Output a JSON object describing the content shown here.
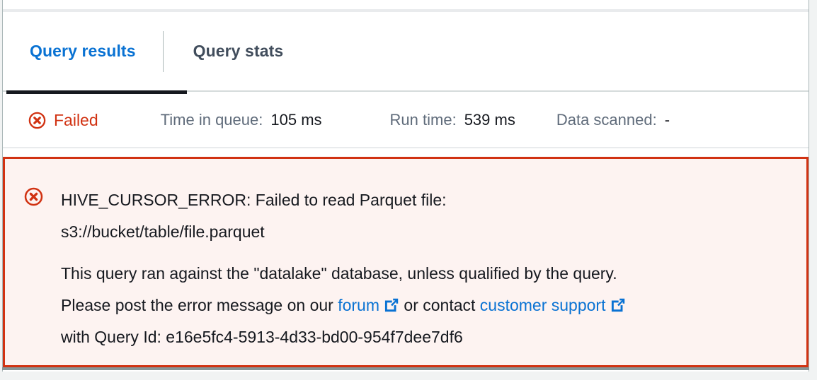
{
  "tabs": [
    {
      "label": "Query results",
      "active": true
    },
    {
      "label": "Query stats",
      "active": false
    }
  ],
  "status": {
    "state_icon": "error-circle-icon",
    "state_label": "Failed",
    "metrics": [
      {
        "label": "Time in queue:",
        "value": "105 ms"
      },
      {
        "label": "Run time:",
        "value": "539 ms"
      },
      {
        "label": "Data scanned:",
        "value": "-"
      }
    ]
  },
  "alert": {
    "icon": "error-circle-icon",
    "title_line1": "HIVE_CURSOR_ERROR: Failed to read Parquet file:",
    "title_line2": "s3://bucket/table/file.parquet",
    "body_line1": "This query ran against the \"datalake\" database, unless qualified by the query.",
    "body_line2_prefix": "Please post the error message on our ",
    "forum_link": "forum",
    "body_line2_middle": " or contact ",
    "support_link": "customer support",
    "body_line3": "with Query Id: e16e5fc4-5913-4d33-bd00-954f7dee7df6"
  },
  "colors": {
    "accent_blue": "#0972d3",
    "error_red": "#d13212",
    "alert_bg": "#fdf3f1",
    "text_dark": "#16191f",
    "text_muted": "#5f6b7a",
    "tab_underline": "#16191f"
  }
}
